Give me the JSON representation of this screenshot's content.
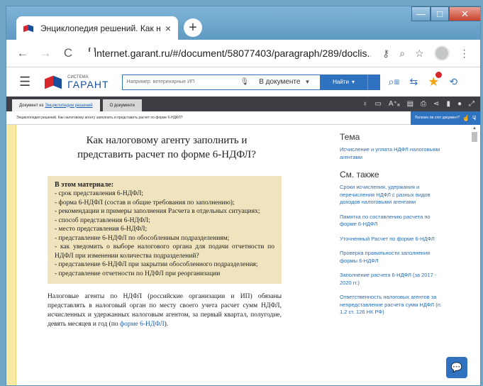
{
  "browser": {
    "tab_title": "Энциклопедия решений. Как н",
    "tab_close": "×",
    "new_tab": "+",
    "url": "internet.garant.ru/#/document/58077403/paragraph/289/doclis...",
    "win_min": "—",
    "win_max": "□",
    "win_close": "✕",
    "back": "←",
    "forward": "→",
    "reload": "C"
  },
  "garant": {
    "logo_small": "СИСТЕМА",
    "logo_name": "ГАРАНТ",
    "search_placeholder": "Например: ветеринарные ИП",
    "scope": "В документе",
    "find_label": "Найти"
  },
  "doc_tabs": {
    "tab1_prefix": "Документ из",
    "tab1_link": "Энциклопедии решений",
    "tab2": "О документе"
  },
  "crumb": "Энциклопедия решений. Как налоговому агенту заполнить и представить расчет по форме 6-НДФЛ?",
  "feedback": "Полезен ли этот документ?",
  "article": {
    "title_line1": "Как налоговому агенту заполнить и",
    "title_line2": "представить расчет по форме 6-НДФЛ?",
    "box_title": "В этом материале:",
    "box_items": [
      "- срок представления 6-НДФЛ;",
      "- форма 6-НДФЛ (состав и общие требования по заполнению);",
      "- рекомендации и примеры заполнения Расчета в отдельных ситуациях;",
      "- способ представления 6-НДФЛ;",
      "- место представления 6-НДФЛ;",
      "- представление 6-НДФЛ по обособленным подразделениям;",
      "- как уведомить о выборе налогового органа для подачи отчетности по НДФЛ при изменении количества подразделений?",
      "- представление 6-НДФЛ при закрытии обособленного подразделения;",
      "- представление отчетности по НДФЛ при реорганизации"
    ],
    "para_text": "Налоговые агенты по НДФЛ (российские организации и ИП) обязаны представлять в налоговый орган по месту своего учета расчет сумм НДФЛ, исчисленных и удержанных налоговым агентом, за первый квартал, полугодие, девять месяцев и год (по ",
    "para_link": "форме 6-НДФЛ",
    "para_end": ")."
  },
  "sidebar": {
    "theme_heading": "Тема",
    "theme_link": "Исчисление и уплата НДФЛ налоговыми агентами",
    "see_also_heading": "См. также",
    "links": [
      "Сроки исчисления, удержания и перечисления НДФЛ с разных видов доходов налоговыми агентами",
      "Памятка по составлению расчета по форме 6-НДФЛ",
      "Уточненный Расчет по форме 6-НДФЛ",
      "Проверка правильности заполнения формы 6-НДФЛ",
      "Заполнение расчета 6-НДФЛ (за 2017 - 2020 гг.)",
      "Ответственность налоговых агентов за непредставление расчета сумм НДФЛ (п. 1.2 ст. 126 НК РФ)"
    ]
  }
}
